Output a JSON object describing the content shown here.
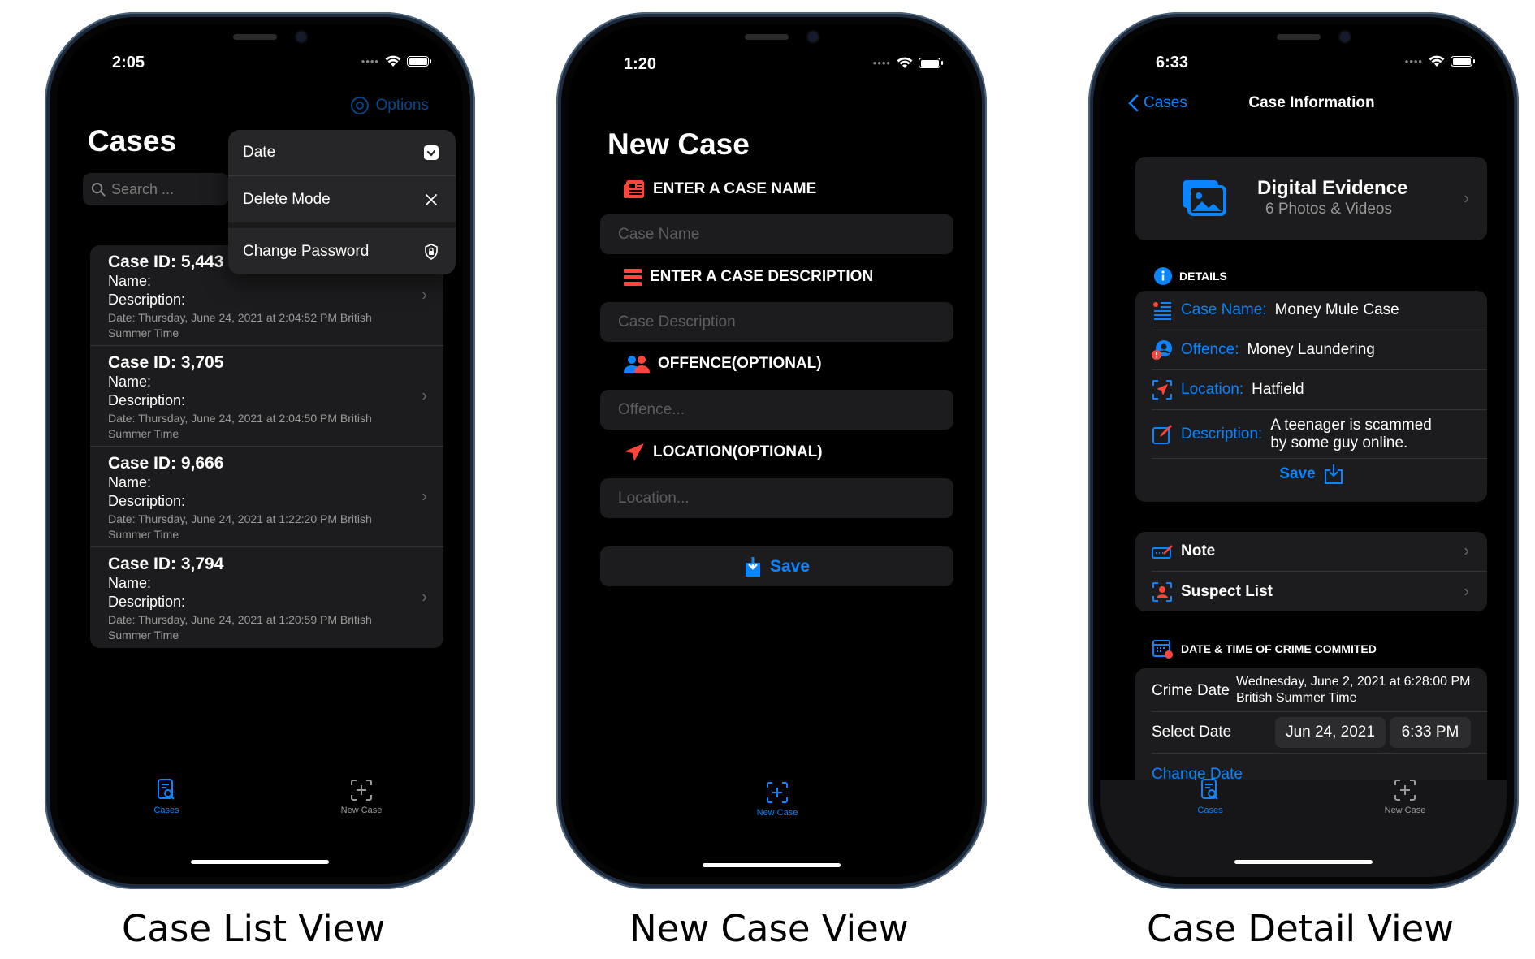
{
  "captions": [
    "Case List View",
    "New Case View",
    "Case Detail View"
  ],
  "colors": {
    "accent": "#0a84ff",
    "danger": "#ff453a",
    "card": "#1c1c1e"
  },
  "list_view": {
    "status_time": "2:05",
    "options_label": "Options",
    "title": "Cases",
    "search_placeholder": "Search ...",
    "menu": [
      {
        "label": "Date",
        "icon": "checkbox-checked-icon"
      },
      {
        "label": "Delete Mode",
        "icon": "close-icon"
      },
      {
        "label": "Change Password",
        "icon": "shield-lock-icon"
      }
    ],
    "cases": [
      {
        "id": "Case ID: 5,443",
        "name": "Name:",
        "description": "Description:",
        "date": "Date: Thursday, June 24, 2021 at 2:04:52 PM British Summer Time"
      },
      {
        "id": "Case ID: 3,705",
        "name": "Name:",
        "description": "Description:",
        "date": "Date: Thursday, June 24, 2021 at 2:04:50 PM British Summer Time"
      },
      {
        "id": "Case ID: 9,666",
        "name": "Name:",
        "description": "Description:",
        "date": "Date: Thursday, June 24, 2021 at 1:22:20 PM British Summer Time"
      },
      {
        "id": "Case ID: 3,794",
        "name": "Name:",
        "description": "Description:",
        "date": "Date: Thursday, June 24, 2021 at 1:20:59 PM British Summer Time"
      }
    ],
    "tabs": [
      {
        "label": "Cases",
        "active": true
      },
      {
        "label": "New Case",
        "active": false
      }
    ]
  },
  "new_view": {
    "status_time": "1:20",
    "title": "New Case",
    "sections": [
      {
        "header": "ENTER A CASE NAME",
        "placeholder": "Case Name"
      },
      {
        "header": "ENTER A CASE DESCRIPTION",
        "placeholder": "Case Description"
      },
      {
        "header": "OFFENCE(OPTIONAL)",
        "placeholder": "Offence..."
      },
      {
        "header": "LOCATION(OPTIONAL)",
        "placeholder": "Location..."
      }
    ],
    "save_label": "Save",
    "tabs": [
      {
        "label": "New Case",
        "active": true
      }
    ]
  },
  "detail_view": {
    "status_time": "6:33",
    "back_label": "Cases",
    "nav_title": "Case Information",
    "evidence_title": "Digital Evidence",
    "evidence_sub": "6 Photos & Videos",
    "details_header": "DETAILS",
    "details": [
      {
        "key": "Case Name:",
        "value": "Money Mule Case"
      },
      {
        "key": "Offence:",
        "value": "Money Laundering"
      },
      {
        "key": "Location:",
        "value": "Hatfield"
      },
      {
        "key": "Description:",
        "value": "A teenager is scammed by some guy online."
      }
    ],
    "save_label": "Save",
    "links": [
      {
        "label": "Note"
      },
      {
        "label": "Suspect List"
      }
    ],
    "crime_header": "DATE & TIME OF CRIME COMMITED",
    "crime_date_label": "Crime Date",
    "crime_date_value": "Wednesday, June 2, 2021 at 6:28:00 PM British Summer Time",
    "select_date_label": "Select Date",
    "select_date": "Jun 24, 2021",
    "select_time": "6:33 PM",
    "change_date_label": "Change Date",
    "tabs": [
      {
        "label": "Cases",
        "active": true
      },
      {
        "label": "New Case",
        "active": false
      }
    ]
  }
}
